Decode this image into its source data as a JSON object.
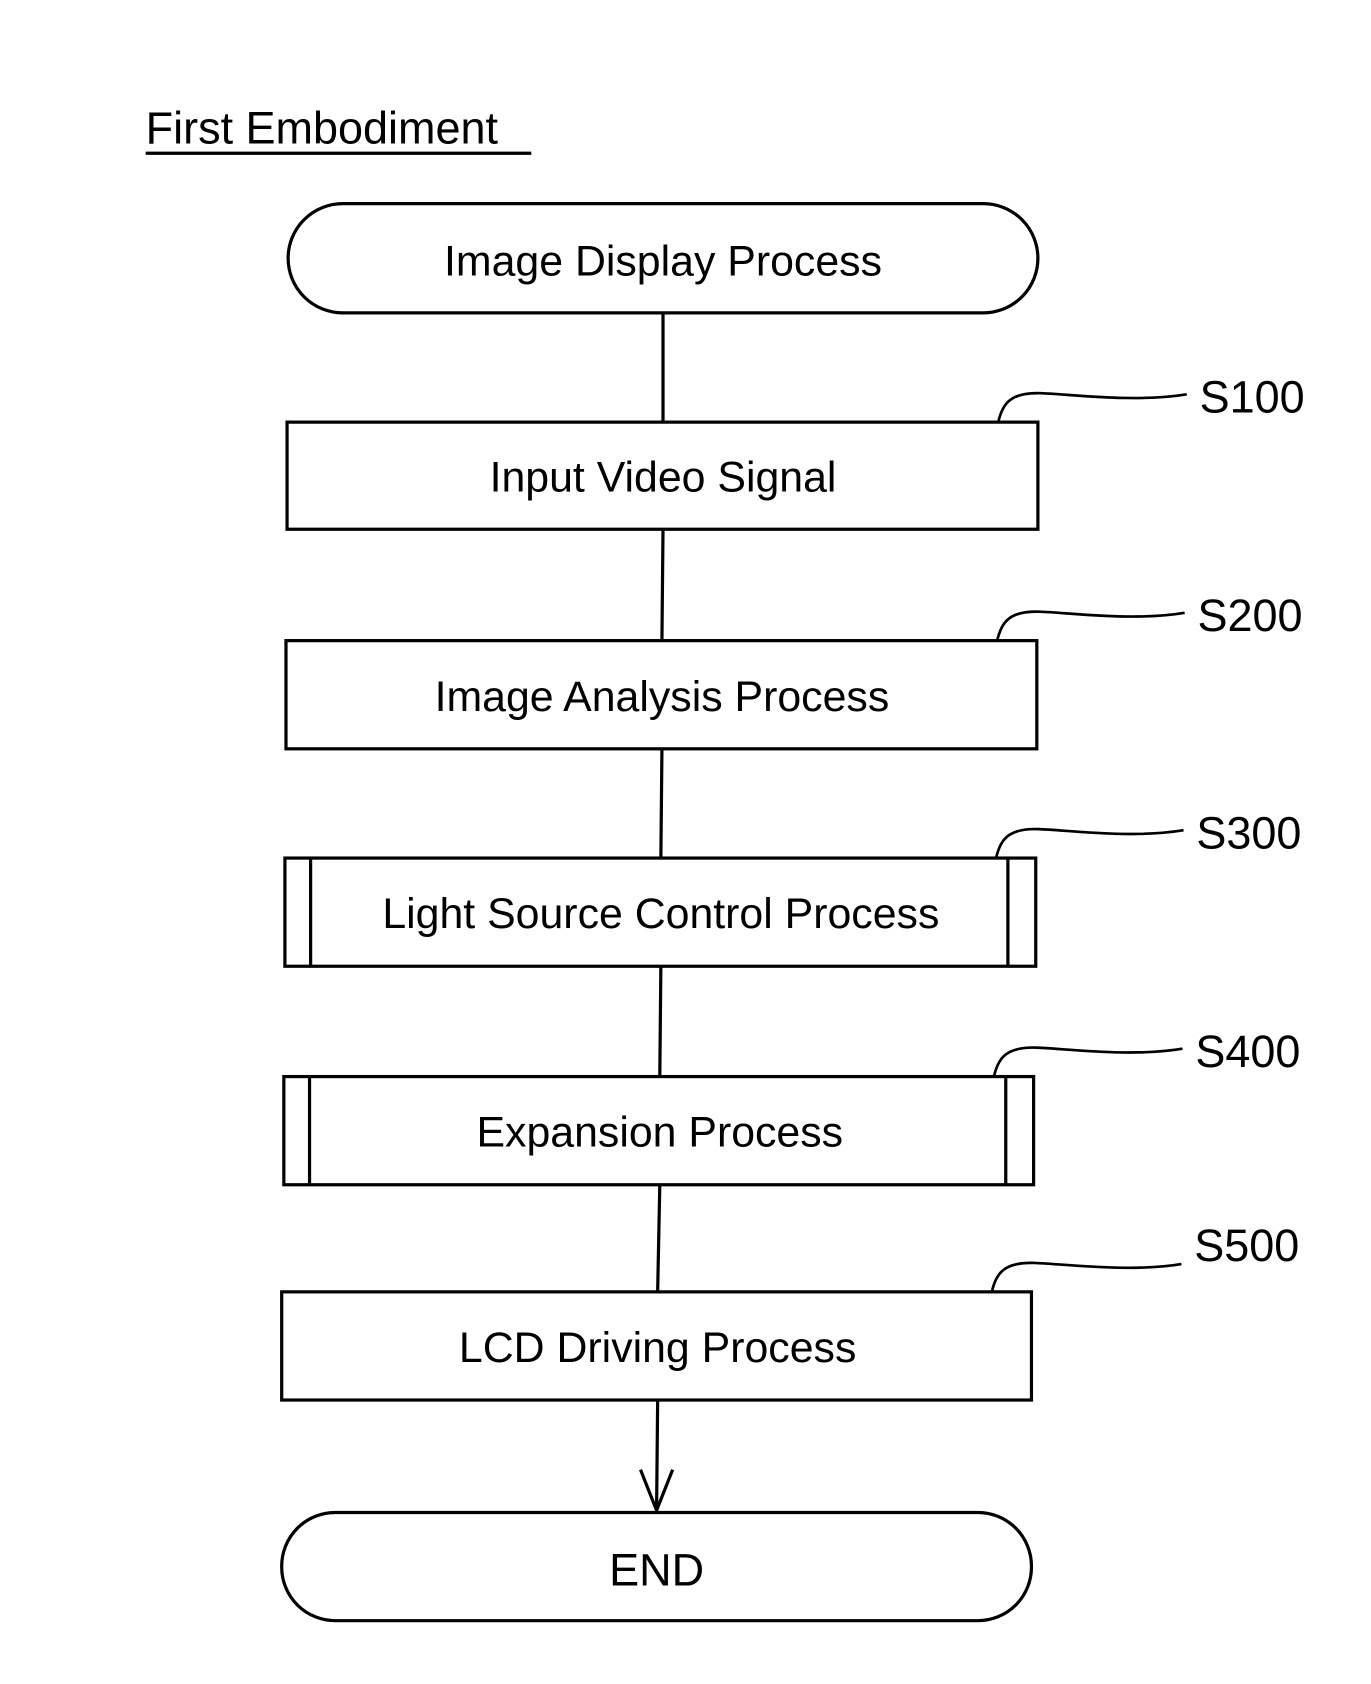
{
  "title": "First Embodiment",
  "start": {
    "label": "Image Display Process"
  },
  "steps": [
    {
      "id": "S100",
      "label": "Input Video Signal",
      "kind": "process"
    },
    {
      "id": "S200",
      "label": "Image Analysis Process",
      "kind": "process"
    },
    {
      "id": "S300",
      "label": "Light Source Control Process",
      "kind": "subroutine"
    },
    {
      "id": "S400",
      "label": "Expansion Process",
      "kind": "subroutine"
    },
    {
      "id": "S500",
      "label": "LCD Driving Process",
      "kind": "process"
    }
  ],
  "end": {
    "label": "END"
  },
  "colors": {
    "stroke": "#000000",
    "background": "#ffffff"
  }
}
